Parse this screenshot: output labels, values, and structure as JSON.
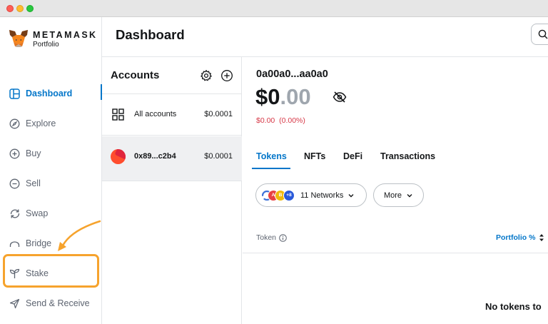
{
  "window": {
    "controls": [
      "close",
      "minimize",
      "maximize"
    ]
  },
  "brand": {
    "name": "METAMASK",
    "subtitle": "Portfolio"
  },
  "sidebar": {
    "items": [
      {
        "label": "Dashboard",
        "icon": "dashboard-icon",
        "active": true
      },
      {
        "label": "Explore",
        "icon": "compass-icon"
      },
      {
        "label": "Buy",
        "icon": "plus-circle-icon"
      },
      {
        "label": "Sell",
        "icon": "minus-circle-icon"
      },
      {
        "label": "Swap",
        "icon": "swap-icon"
      },
      {
        "label": "Bridge",
        "icon": "bridge-icon"
      },
      {
        "label": "Stake",
        "icon": "sprout-icon",
        "highlighted": true
      },
      {
        "label": "Send & Receive",
        "icon": "send-icon"
      }
    ]
  },
  "header": {
    "title": "Dashboard",
    "search_icon": "search-icon"
  },
  "accounts": {
    "title": "Accounts",
    "rows": [
      {
        "name": "All accounts",
        "value": "$0.0001",
        "icon": "grid-icon"
      },
      {
        "name": "0x89...c2b4",
        "value": "$0.0001",
        "icon": "account-avatar",
        "selected": true
      }
    ]
  },
  "main": {
    "account_name": "0a00a0...aa0a0",
    "balance_whole": "$0",
    "balance_cents": ".00",
    "change": "$0.00  (0.00%)",
    "tabs": [
      "Tokens",
      "NFTs",
      "DeFi",
      "Transactions"
    ],
    "active_tab": "Tokens",
    "networks_label": "11 Networks",
    "networks_extra": "+8",
    "more_label": "More",
    "table": {
      "token_col": "Token",
      "portfolio_col": "Portfolio %"
    },
    "empty_message": "No tokens to"
  },
  "colors": {
    "accent": "#0376c9",
    "highlight": "#f6a32d",
    "negative": "#d73847",
    "selected_row": "#eff0f2"
  }
}
